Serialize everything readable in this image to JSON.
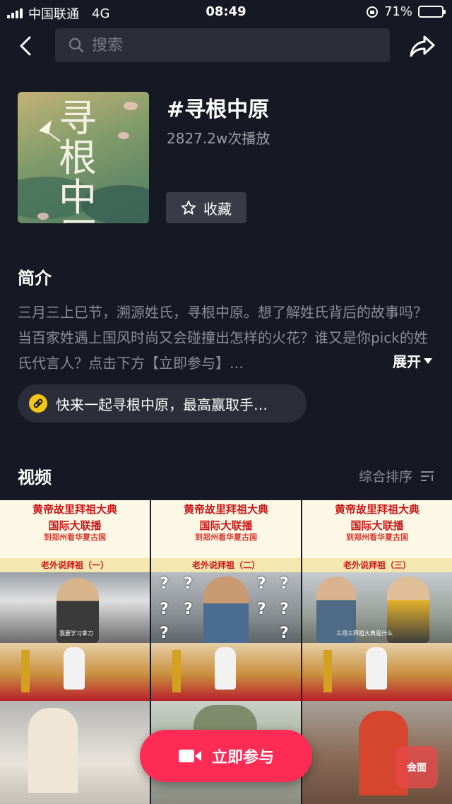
{
  "status_bar": {
    "carrier": "中国联通",
    "network": "4G",
    "time": "08:49",
    "battery": "71%",
    "battery_level": 0.71
  },
  "header": {
    "back_icon": "chevron-left-icon",
    "search_placeholder": "搜索",
    "search_icon": "search-icon",
    "share_icon": "share-icon"
  },
  "topic": {
    "cover_art_text": "寻根中原",
    "title": "#寻根中原",
    "play_count": "2827.2w次播放",
    "favorite_label": "收藏",
    "favorite_icon": "star-icon"
  },
  "intro": {
    "heading": "简介",
    "text": "三月三上巳节，溯源姓氏，寻根中原。想了解姓氏背后的故事吗？当百家姓遇上国风时尚又会碰撞出怎样的火花？谁又是你pick的姓氏代言人？点击下方【立即参与】…",
    "expand_label": "展开"
  },
  "link": {
    "icon": "link-icon",
    "text": "快来一起寻根中原，最高赢取手…"
  },
  "videos": {
    "heading": "视频",
    "sort_label": "综合排序",
    "sort_icon": "sort-icon",
    "items": [
      {
        "banner_title": "黄帝故里拜祖大典",
        "banner_title2": "国际大联播",
        "banner_subtitle": "到郑州看华夏古国",
        "episode": "老外说拜祖（一）",
        "caption": "我要学习拿刀"
      },
      {
        "banner_title": "黄帝故里拜祖大典",
        "banner_title2": "国际大联播",
        "banner_subtitle": "到郑州看华夏古国",
        "episode": "老外说拜祖（二）",
        "caption": ""
      },
      {
        "banner_title": "黄帝故里拜祖大典",
        "banner_title2": "国际大联播",
        "banner_subtitle": "到郑州看华夏古国",
        "episode": "老外说拜祖（三）",
        "caption": "三月三拜祖大典是什么"
      }
    ]
  },
  "join_button": {
    "label": "立即参与",
    "icon": "video-camera-icon"
  },
  "watermark": {
    "text": "会面"
  },
  "colors": {
    "background": "#161823",
    "accent": "#fe2c55",
    "secondary_text": "#8b8d96"
  }
}
